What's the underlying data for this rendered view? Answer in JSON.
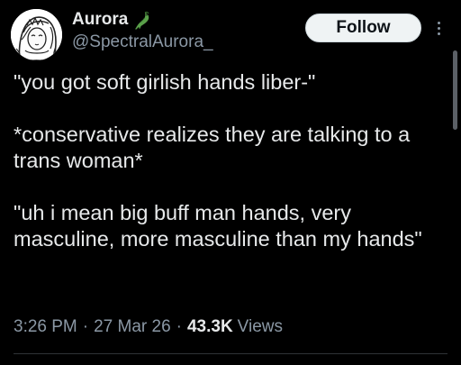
{
  "author": {
    "display_name": "Aurora",
    "handle": "@SpectralAurora_",
    "badge_icon": "crocodile-emoji-icon"
  },
  "actions": {
    "follow_label": "Follow",
    "more_icon": "more-vertical-icon"
  },
  "tweet": {
    "paragraphs": [
      "\"you got soft girlish hands liber-\"",
      "*conservative realizes they are talking to a trans woman*",
      "\"uh i mean big buff man hands, very masculine, more masculine than my hands\""
    ]
  },
  "meta": {
    "time": "3:26 PM",
    "separator": "·",
    "date": "27 Mar 26",
    "views_count": "43.3K",
    "views_label": "Views"
  },
  "colors": {
    "background": "#000000",
    "text_primary": "#e7e9ea",
    "text_secondary": "#8b98a5",
    "follow_bg": "#eff3f4",
    "follow_text": "#0f1419"
  }
}
